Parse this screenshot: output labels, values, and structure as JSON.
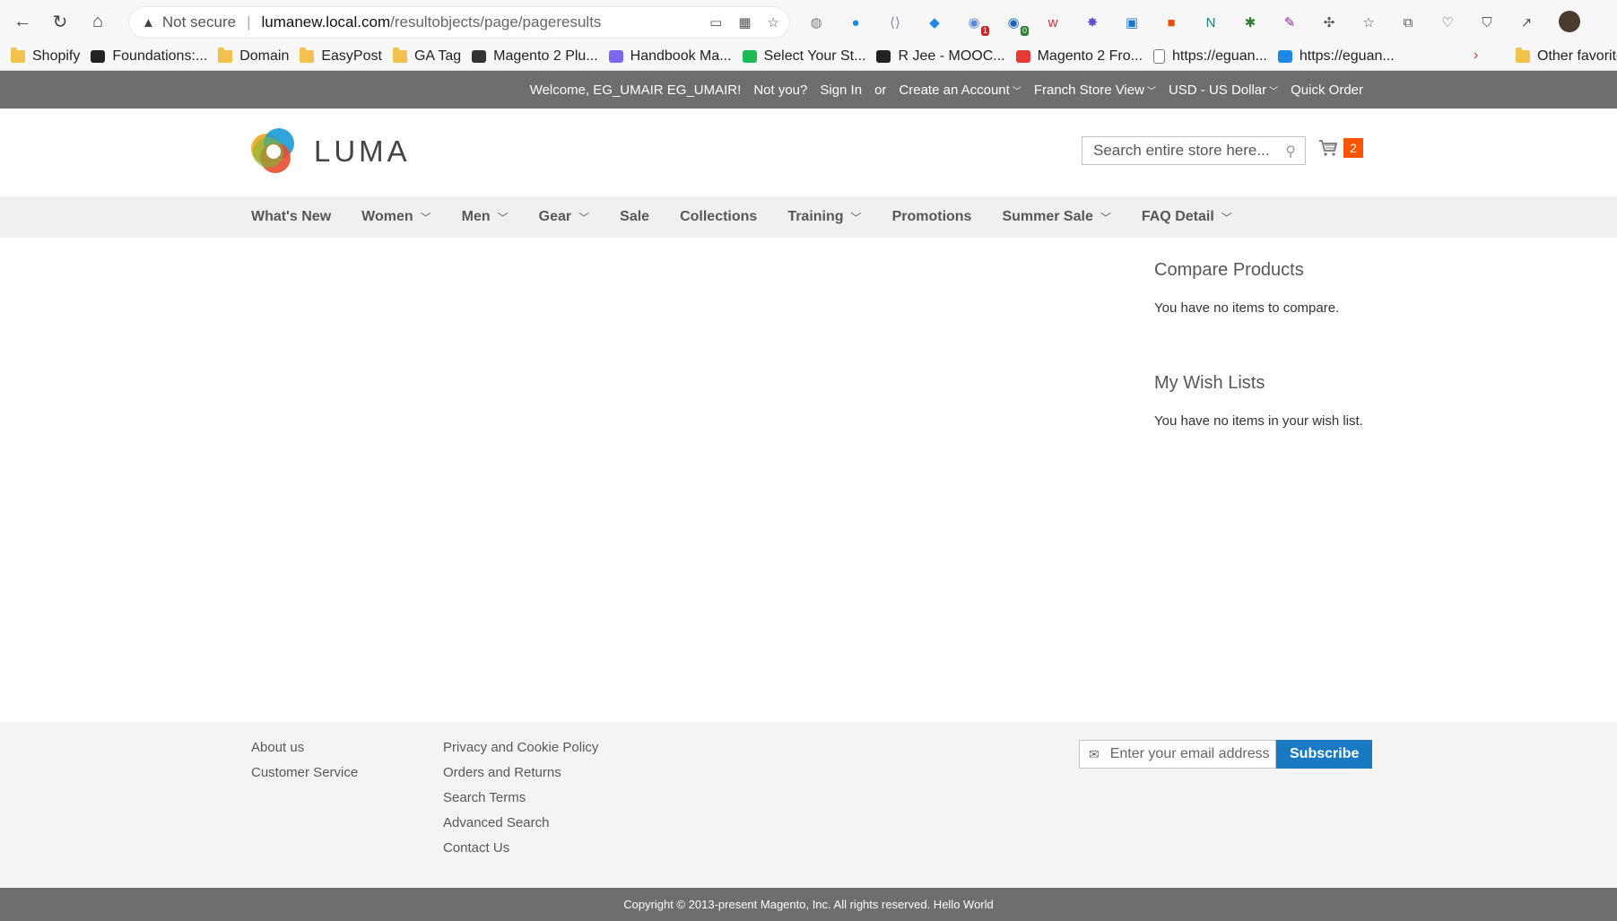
{
  "browser": {
    "insecure_label": "Not secure",
    "url_host": "lumanew.local.com",
    "url_path": "/resultobjects/page/pageresults",
    "extensions": [
      {
        "icon": "globe-icon",
        "glyph": "◍",
        "color": "#777",
        "badge": ""
      },
      {
        "icon": "ext-blue-circle-icon",
        "glyph": "●",
        "color": "#1e88e5",
        "badge": ""
      },
      {
        "icon": "code-icon",
        "glyph": "⟨⟩",
        "color": "#7a8a9a",
        "badge": ""
      },
      {
        "icon": "tag-icon",
        "glyph": "◆",
        "color": "#1e88e5",
        "badge": ""
      },
      {
        "icon": "ext-globe-badge-icon",
        "glyph": "◉",
        "color": "#5b8bd6",
        "badge": "1"
      },
      {
        "icon": "ext-globe-badge-icon",
        "glyph": "◉",
        "color": "#1565c0",
        "badge": "0"
      },
      {
        "icon": "ext-red-icon",
        "glyph": "w",
        "color": "#d32f2f",
        "badge": ""
      },
      {
        "icon": "ext-star-icon",
        "glyph": "✸",
        "color": "#5c4bd6",
        "badge": ""
      },
      {
        "icon": "ext-panel-icon",
        "glyph": "▣",
        "color": "#1976d2",
        "badge": ""
      },
      {
        "icon": "ext-color-icon",
        "glyph": "■",
        "color": "#e65100",
        "badge": ""
      },
      {
        "icon": "ext-n-icon",
        "glyph": "N",
        "color": "#00897b",
        "badge": ""
      },
      {
        "icon": "ext-gear-green-icon",
        "glyph": "✱",
        "color": "#2e7d32",
        "badge": ""
      },
      {
        "icon": "ext-feather-icon",
        "glyph": "✎",
        "color": "#8e24aa",
        "badge": ""
      },
      {
        "icon": "extensions-icon",
        "glyph": "✣",
        "color": "#555",
        "badge": ""
      },
      {
        "icon": "favorites-icon",
        "glyph": "☆",
        "color": "#555",
        "badge": ""
      },
      {
        "icon": "collections-icon",
        "glyph": "⧉",
        "color": "#555",
        "badge": ""
      },
      {
        "icon": "performance-icon",
        "glyph": "♡",
        "color": "#555",
        "badge": ""
      },
      {
        "icon": "browser-essentials-icon",
        "glyph": "⛉",
        "color": "#555",
        "badge": ""
      },
      {
        "icon": "share-icon",
        "glyph": "↗",
        "color": "#555",
        "badge": ""
      }
    ],
    "bookmarks": [
      {
        "label": "Shopify",
        "icon": "folder"
      },
      {
        "label": "Foundations:...",
        "icon": "shopify"
      },
      {
        "label": "Domain",
        "icon": "folder"
      },
      {
        "label": "EasyPost",
        "icon": "folder"
      },
      {
        "label": "GA Tag",
        "icon": "folder"
      },
      {
        "label": "Magento 2 Plu...",
        "icon": "bird"
      },
      {
        "label": "Handbook Ma...",
        "icon": "book"
      },
      {
        "label": "Select Your St...",
        "icon": "leaf"
      },
      {
        "label": "R Jee - MOOC...",
        "icon": "cc"
      },
      {
        "label": "Magento 2 Fro...",
        "icon": "adobe"
      },
      {
        "label": "https://eguan...",
        "icon": "page"
      },
      {
        "label": "https://eguan...",
        "icon": "cloud"
      }
    ],
    "other_favorites": "Other favorites"
  },
  "store": {
    "topbar": {
      "welcome": "Welcome, EG_UMAIR EG_UMAIR!",
      "not_you": "Not you?",
      "sign_in": "Sign In",
      "or": "or",
      "create_account": "Create an Account",
      "store_view": "Franch Store View",
      "currency": "USD - US Dollar",
      "quick_order": "Quick Order"
    },
    "logo_text": "LUMA",
    "search_placeholder": "Search entire store here...",
    "cart_count": "2",
    "nav": [
      {
        "label": "What's New",
        "dropdown": false
      },
      {
        "label": "Women",
        "dropdown": true
      },
      {
        "label": "Men",
        "dropdown": true
      },
      {
        "label": "Gear",
        "dropdown": true
      },
      {
        "label": "Sale",
        "dropdown": false
      },
      {
        "label": "Collections",
        "dropdown": false
      },
      {
        "label": "Training",
        "dropdown": true
      },
      {
        "label": "Promotions",
        "dropdown": false
      },
      {
        "label": "Summer Sale",
        "dropdown": true
      },
      {
        "label": "FAQ Detail",
        "dropdown": true
      }
    ],
    "sidebar": {
      "compare_title": "Compare Products",
      "compare_text": "You have no items to compare.",
      "wishlist_title": "My Wish Lists",
      "wishlist_text": "You have no items in your wish list."
    },
    "footer": {
      "col1": [
        "About us",
        "Customer Service"
      ],
      "col2": [
        "Privacy and Cookie Policy",
        "Orders and Returns",
        "Search Terms",
        "Advanced Search",
        "Contact Us"
      ],
      "newsletter_placeholder": "Enter your email address",
      "subscribe": "Subscribe",
      "copyright": "Copyright © 2013-present Magento, Inc. All rights reserved. Hello World"
    },
    "colors": {
      "accent": "#1979c3",
      "cart_badge": "#ff5501",
      "bar": "#6e6e6e"
    }
  }
}
